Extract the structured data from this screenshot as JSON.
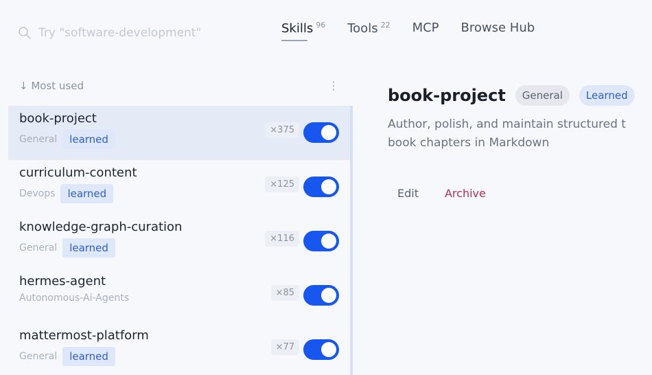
{
  "search": {
    "placeholder": "Try \"software-development\"",
    "value": ""
  },
  "tabs": [
    {
      "label": "Skills",
      "count": "96"
    },
    {
      "label": "Tools",
      "count": "22"
    },
    {
      "label": "MCP"
    },
    {
      "label": "Browse Hub"
    }
  ],
  "list": {
    "sort_label": "↓ Most used",
    "menu_glyph": "⋮",
    "items": [
      {
        "name": "book-project",
        "category": "General",
        "badge": "learned",
        "count": "×375"
      },
      {
        "name": "curriculum-content",
        "category": "Devops",
        "badge": "learned",
        "count": "×125"
      },
      {
        "name": "knowledge-graph-curation",
        "category": "General",
        "badge": "learned",
        "count": "×116"
      },
      {
        "name": "hermes-agent",
        "category": "Autonomous-Ai-Agents",
        "count": "×85"
      },
      {
        "name": "mattermost-platform",
        "category": "General",
        "badge": "learned",
        "count": "×77"
      }
    ]
  },
  "detail": {
    "title": "book-project",
    "category_pill": "General",
    "learned_pill": "Learned",
    "description_line1": "Author, polish, and maintain structured t",
    "description_line2": "book chapters in Markdown",
    "edit_label": "Edit",
    "archive_label": "Archive"
  },
  "colors": {
    "accent": "#1856f0",
    "selected_row": "#e4eaf6",
    "archive": "#b0324f"
  }
}
